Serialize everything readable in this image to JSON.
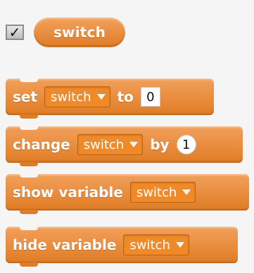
{
  "reporter": {
    "checked": true,
    "check_glyph": "✓",
    "label": "switch"
  },
  "blocks": [
    {
      "words": [
        "set",
        "to"
      ],
      "dropdown": "switch",
      "input": "0",
      "input_shape": "square"
    },
    {
      "words": [
        "change",
        "by"
      ],
      "dropdown": "switch",
      "input": "1",
      "input_shape": "round"
    },
    {
      "words": [
        "show variable"
      ],
      "dropdown": "switch"
    },
    {
      "words": [
        "hide variable"
      ],
      "dropdown": "switch"
    }
  ],
  "colors": {
    "block_orange": "#e07c25",
    "background": "#f5f5f5"
  }
}
